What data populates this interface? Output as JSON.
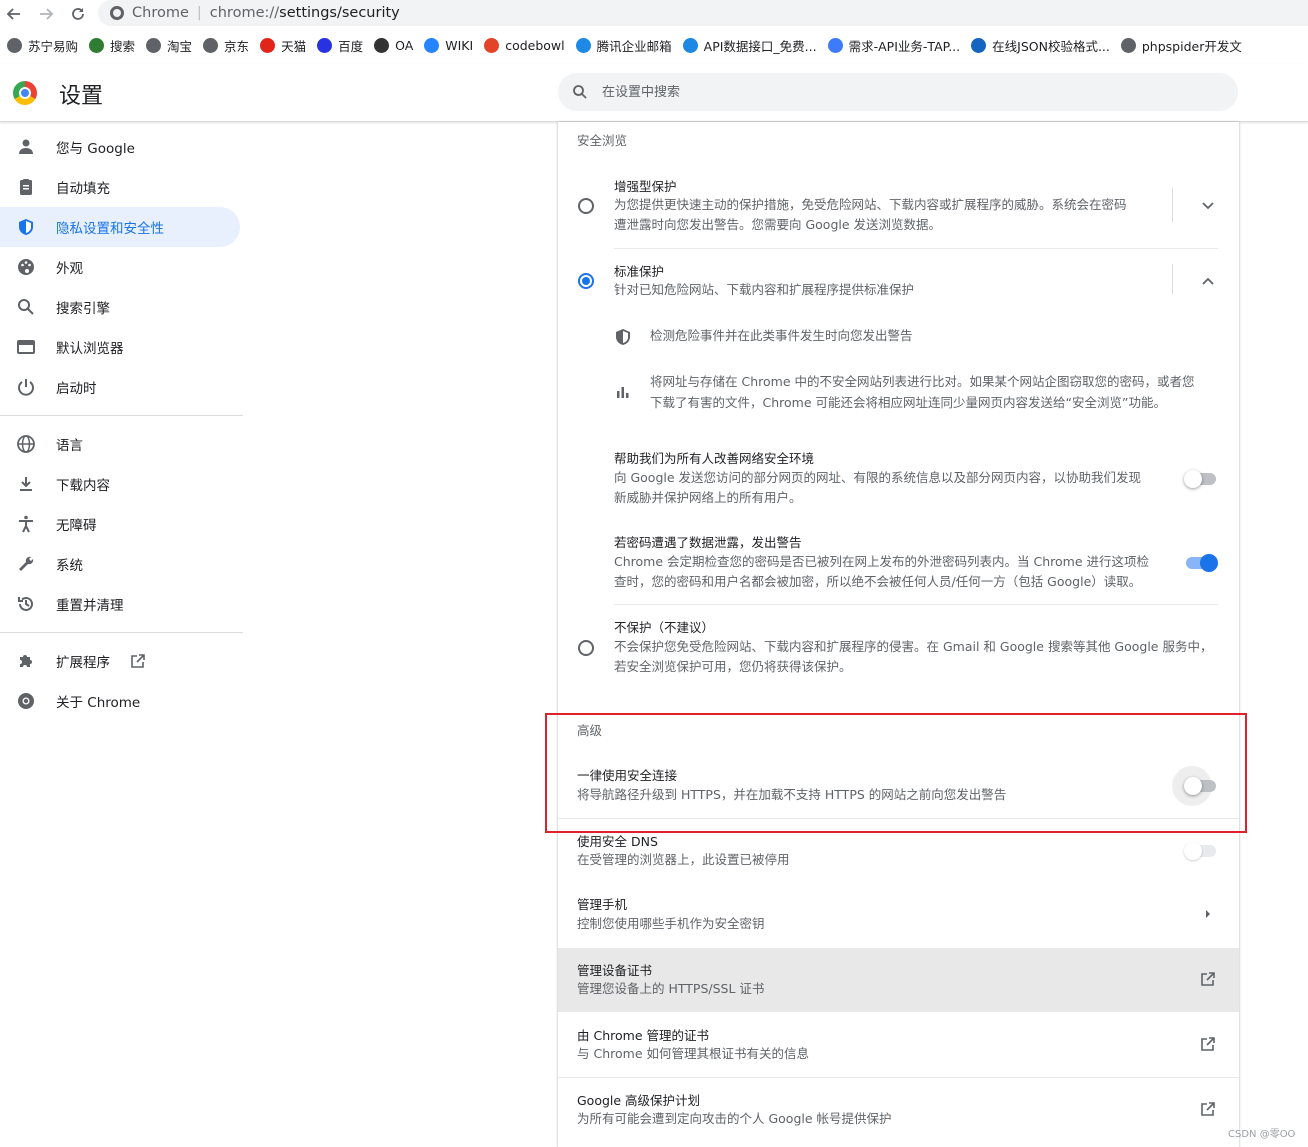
{
  "browser": {
    "tab_label": "Chrome",
    "url_prefix": "chrome://",
    "url_path": "settings/security"
  },
  "bookmarks": [
    {
      "label": "苏宁易购",
      "icon": "globe-icon",
      "color": "#5f6368"
    },
    {
      "label": "搜索",
      "icon": "search-engine-icon",
      "color": "#2e7d32"
    },
    {
      "label": "淘宝",
      "icon": "globe-icon",
      "color": "#5f6368"
    },
    {
      "label": "京东",
      "icon": "globe-icon",
      "color": "#5f6368"
    },
    {
      "label": "天猫",
      "icon": "tmall-icon",
      "color": "#e1251b"
    },
    {
      "label": "百度",
      "icon": "baidu-icon",
      "color": "#2932e1"
    },
    {
      "label": "OA",
      "icon": "oa-icon",
      "color": "#333333"
    },
    {
      "label": "WIKI",
      "icon": "wiki-icon",
      "color": "#2684ff"
    },
    {
      "label": "codebowl",
      "icon": "gitlab-icon",
      "color": "#e24329"
    },
    {
      "label": "腾讯企业邮箱",
      "icon": "mail-icon",
      "color": "#1e88e5"
    },
    {
      "label": "API数据接口_免费...",
      "icon": "api-icon",
      "color": "#1e88e5"
    },
    {
      "label": "需求-API业务-TAP...",
      "icon": "tapd-icon",
      "color": "#3e7bfa"
    },
    {
      "label": "在线JSON校验格式...",
      "icon": "json-icon",
      "color": "#1565c0"
    },
    {
      "label": "phpspider开发文",
      "icon": "globe-icon",
      "color": "#5f6368"
    }
  ],
  "header": {
    "title": "设置",
    "search_placeholder": "在设置中搜索"
  },
  "sidebar": {
    "items": [
      {
        "label": "您与 Google",
        "icon": "person-icon"
      },
      {
        "label": "自动填充",
        "icon": "clipboard-icon"
      },
      {
        "label": "隐私设置和安全性",
        "icon": "shield-icon",
        "active": true
      },
      {
        "label": "外观",
        "icon": "palette-icon"
      },
      {
        "label": "搜索引擎",
        "icon": "search-icon"
      },
      {
        "label": "默认浏览器",
        "icon": "browser-window-icon"
      },
      {
        "label": "启动时",
        "icon": "power-icon"
      },
      {
        "label": "语言",
        "icon": "globe-icon"
      },
      {
        "label": "下载内容",
        "icon": "download-icon"
      },
      {
        "label": "无障碍",
        "icon": "accessibility-icon"
      },
      {
        "label": "系统",
        "icon": "wrench-icon"
      },
      {
        "label": "重置并清理",
        "icon": "history-icon"
      },
      {
        "label": "扩展程序",
        "icon": "puzzle-icon"
      },
      {
        "label": "关于 Chrome",
        "icon": "chrome-icon"
      }
    ]
  },
  "safe_browsing": {
    "section_title": "安全浏览",
    "enhanced": {
      "title": "增强型保护",
      "desc_line1": "为您提供更快速主动的保护措施，免受危险网站、下载内容或扩展程序的威胁。系统会在密码",
      "desc_line2": "遭泄露时向您发出警告。您需要向 Google 发送浏览数据。",
      "selected": false
    },
    "standard": {
      "title": "标准保护",
      "desc": "针对已知危险网站、下载内容和扩展程序提供标准保护",
      "selected": true,
      "bullet1": "检测危险事件并在此类事件发生时向您发出警告",
      "bullet2_line1": "将网址与存储在 Chrome 中的不安全网站列表进行比对。如果某个网站企图窃取您的密码，或者您",
      "bullet2_line2": "下载了有害的文件，Chrome 可能还会将相应网址连同少量网页内容发送给“安全浏览”功能。"
    },
    "help_improve": {
      "title": "帮助我们为所有人改善网络安全环境",
      "desc_line1": "向 Google 发送您访问的部分网页的网址、有限的系统信息以及部分网页内容，以协助我们发现",
      "desc_line2": "新威胁并保护网络上的所有用户。",
      "enabled": false
    },
    "password_leak": {
      "title": "若密码遭遇了数据泄露，发出警告",
      "desc_line1": "Chrome 会定期检查您的密码是否已被列在网上发布的外泄密码列表内。当 Chrome 进行这项检",
      "desc_line2": "查时，您的密码和用户名都会被加密，所以绝不会被任何人员/任何一方（包括 Google）读取。",
      "enabled": true
    },
    "no_protection": {
      "title": "不保护（不建议）",
      "desc_line1": "不会保护您免受危险网站、下载内容和扩展程序的侵害。在 Gmail 和 Google 搜索等其他 Google 服务中，",
      "desc_line2": "若安全浏览保护可用，您仍将获得该保护。",
      "selected": false
    }
  },
  "advanced": {
    "section_title": "高级",
    "https_only": {
      "title": "一律使用安全连接",
      "desc": "将导航路径升级到 HTTPS，并在加载不支持 HTTPS 的网站之前向您发出警告",
      "enabled": false
    },
    "secure_dns": {
      "title": "使用安全 DNS",
      "desc": "在受管理的浏览器上，此设置已被停用",
      "enabled": false
    },
    "manage_phones": {
      "title": "管理手机",
      "desc": "控制您使用哪些手机作为安全密钥"
    },
    "manage_certs": {
      "title": "管理设备证书",
      "desc": "管理您设备上的 HTTPS/SSL 证书"
    },
    "chrome_certs": {
      "title": "由 Chrome 管理的证书",
      "desc": "与 Chrome 如何管理其根证书有关的信息"
    },
    "advanced_protection": {
      "title": "Google 高级保护计划",
      "desc": "为所有可能会遭到定向攻击的个人 Google 帐号提供保护"
    }
  },
  "watermark": "CSDN @零OO",
  "colors": {
    "accent": "#1a73e8",
    "highlight_box": "#e0202a"
  }
}
